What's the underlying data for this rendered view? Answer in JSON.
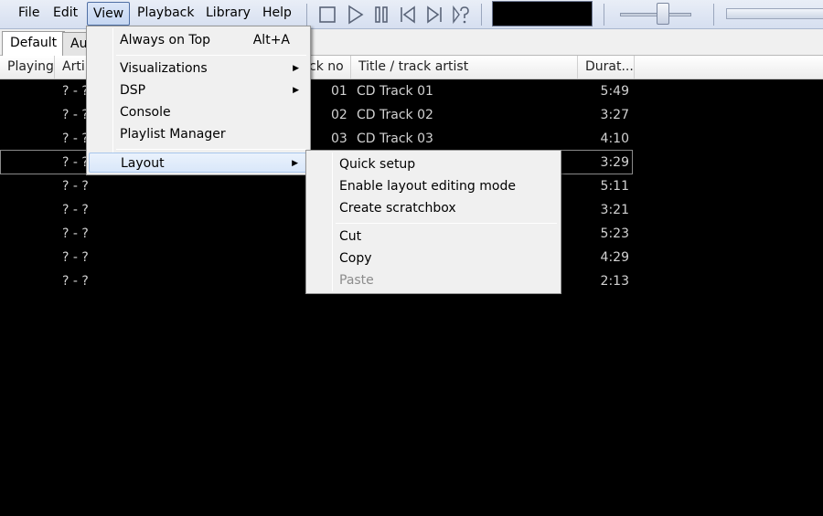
{
  "menubar": {
    "items": [
      "File",
      "Edit",
      "View",
      "Playback",
      "Library",
      "Help"
    ],
    "active": "View"
  },
  "toolbar": {
    "buttons": [
      "stop-icon",
      "play-icon",
      "pause-icon",
      "previous-icon",
      "next-icon",
      "random-icon"
    ],
    "volume_level": 0.62
  },
  "tabs": [
    "Default",
    "Au"
  ],
  "playlist": {
    "columns": [
      "Playing",
      "Arti",
      "ck no",
      "Title / track artist",
      "Durat..."
    ],
    "rows": [
      {
        "artist": "? - ?",
        "no": "01",
        "title": "CD Track 01",
        "duration": "5:49"
      },
      {
        "artist": "? - ?",
        "no": "02",
        "title": "CD Track 02",
        "duration": "3:27"
      },
      {
        "artist": "? - ?",
        "no": "03",
        "title": "CD Track 03",
        "duration": "4:10"
      },
      {
        "artist": "? - ?",
        "no": "",
        "title": "",
        "duration": "3:29"
      },
      {
        "artist": "? - ?",
        "no": "",
        "title": "",
        "duration": "5:11"
      },
      {
        "artist": "? - ?",
        "no": "",
        "title": "",
        "duration": "3:21"
      },
      {
        "artist": "? - ?",
        "no": "",
        "title": "",
        "duration": "5:23"
      },
      {
        "artist": "? - ?",
        "no": "",
        "title": "",
        "duration": "4:29"
      },
      {
        "artist": "? - ?",
        "no": "",
        "title": "",
        "duration": "2:13"
      }
    ]
  },
  "view_menu": {
    "always_on_top": "Always on Top",
    "always_on_top_shortcut": "Alt+A",
    "visualizations": "Visualizations",
    "dsp": "DSP",
    "console": "Console",
    "playlist_manager": "Playlist Manager",
    "layout": "Layout",
    "submenu_arrow": "▶"
  },
  "layout_menu": {
    "quick_setup": "Quick setup",
    "enable_editing": "Enable layout editing mode",
    "create_scratchbox": "Create scratchbox",
    "cut": "Cut",
    "copy": "Copy",
    "paste": "Paste"
  },
  "colors": {
    "menu_highlight": "#d9e7fa",
    "row_text": "#d2d2d2",
    "background": "#000000"
  }
}
